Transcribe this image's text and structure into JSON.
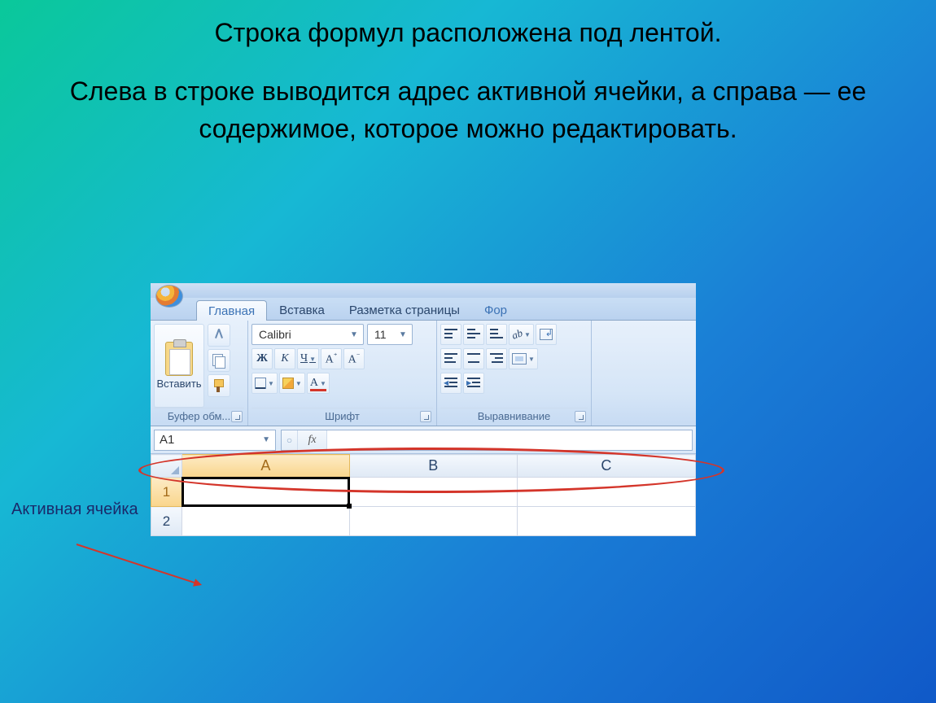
{
  "slide": {
    "line1": "Строка формул расположена под лентой.",
    "para": "Слева в строке выводится адрес активной ячейки, а справа — ее содержимое, которое можно редактировать."
  },
  "callout": {
    "text": "Активная ячейка"
  },
  "tabs": {
    "home": "Главная",
    "insert": "Вставка",
    "page_layout": "Разметка страницы",
    "formulas_partial": "Фор"
  },
  "ribbon": {
    "clipboard": {
      "paste": "Вставить",
      "caption": "Буфер обм..."
    },
    "font": {
      "name": "Calibri",
      "size": "11",
      "bold": "Ж",
      "italic": "К",
      "underline": "Ч",
      "grow": "А",
      "shrink": "А",
      "font_color_letter": "А",
      "caption": "Шрифт"
    },
    "alignment": {
      "caption": "Выравнивание"
    }
  },
  "formula_bar": {
    "name_box": "A1",
    "fx": "fx",
    "value": ""
  },
  "grid": {
    "columns": [
      "A",
      "B",
      "C"
    ],
    "rows": [
      "1",
      "2"
    ],
    "active_cell": "A1"
  }
}
